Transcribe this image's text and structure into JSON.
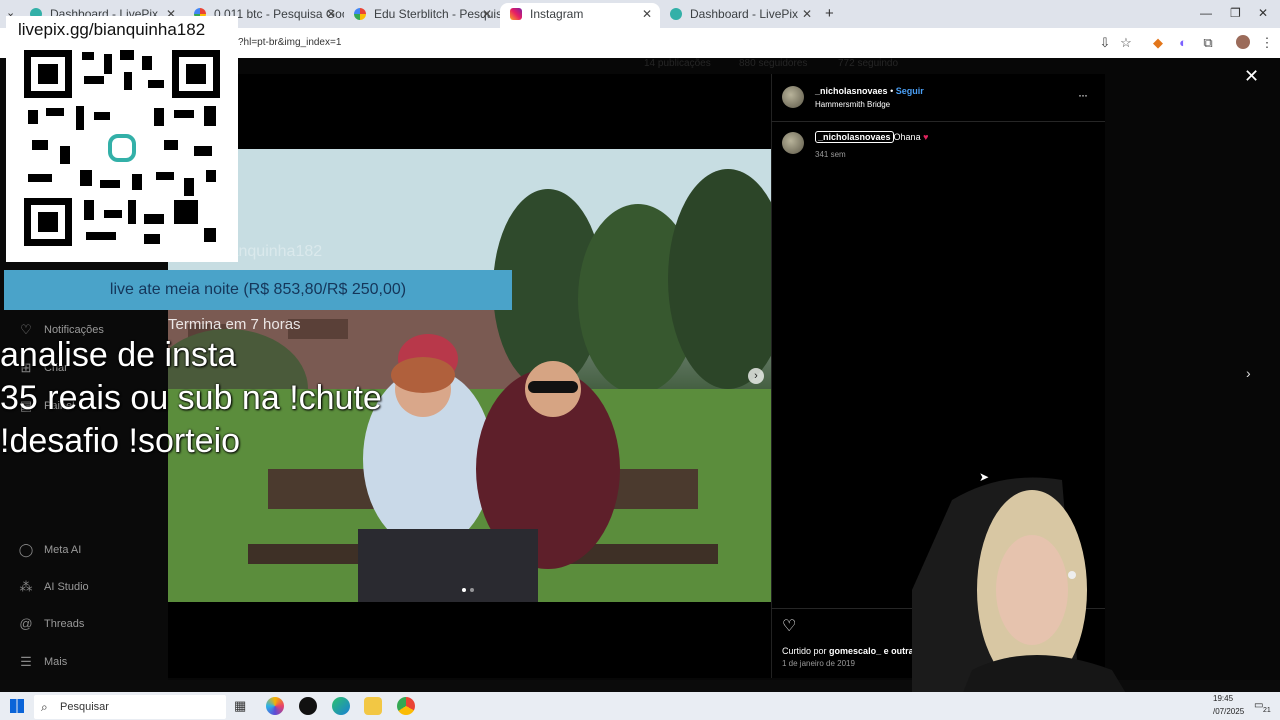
{
  "browser": {
    "tabs": [
      {
        "label": "Dashboard - LivePix",
        "active": false
      },
      {
        "label": "0,011 btc - Pesquisa Google",
        "active": false
      },
      {
        "label": "Edu Sterblitch - Pesquisa Google",
        "active": false
      },
      {
        "label": "Instagram",
        "active": true
      },
      {
        "label": "Dashboard - LivePix",
        "active": false
      }
    ],
    "url": "?hl=pt-br&img_index=1",
    "new_tab": "+"
  },
  "profile_stats": {
    "posts": "14 publicações",
    "followers": "880 seguidores",
    "following": "772 seguindo"
  },
  "sidebar": {
    "items": [
      {
        "label": "Notificações",
        "icon": "heart-icon"
      },
      {
        "label": "Criar",
        "icon": "plus-icon"
      },
      {
        "label": "Painel",
        "icon": "chart-icon"
      },
      {
        "label": "Meta AI",
        "icon": "circle-icon"
      },
      {
        "label": "AI Studio",
        "icon": "studio-icon"
      },
      {
        "label": "Threads",
        "icon": "threads-icon"
      },
      {
        "label": "Mais",
        "icon": "menu-icon"
      }
    ]
  },
  "post": {
    "username": "_nicholasnovaes",
    "dot": "•",
    "follow": "Seguir",
    "location": "Hammersmith Bridge",
    "caption_user": "_nicholasnovaes",
    "caption_text": "Ohana",
    "caption_emoji": "♥",
    "age": "341 sem",
    "liked_by_prefix": "Curtido por",
    "liked_by_user": "gomescalo_",
    "liked_by_suffix": "e outras pe",
    "date": "1 de janeiro de 2019",
    "more": "···"
  },
  "stream_overlay": {
    "qr_url": "livepix.gg/bianquinha182",
    "qr_watermark": "livepix.gg/bianquinha182",
    "goal": "live ate meia noite (R$ 853,80/R$ 250,00)",
    "goal_progress": 1.0,
    "goal_sub": "Termina em 7 horas",
    "lines": [
      "analise de insta",
      "35 reais ou sub na !chute",
      "!desafio !sorteio"
    ]
  },
  "taskbar": {
    "search_placeholder": "Pesquisar",
    "time": "19:45",
    "date": "/07/2025",
    "notif_count": "21"
  },
  "colors": {
    "accent_blue": "#4aa3c9",
    "instagram_link": "#4a9ff5",
    "heart": "#e0245e"
  }
}
